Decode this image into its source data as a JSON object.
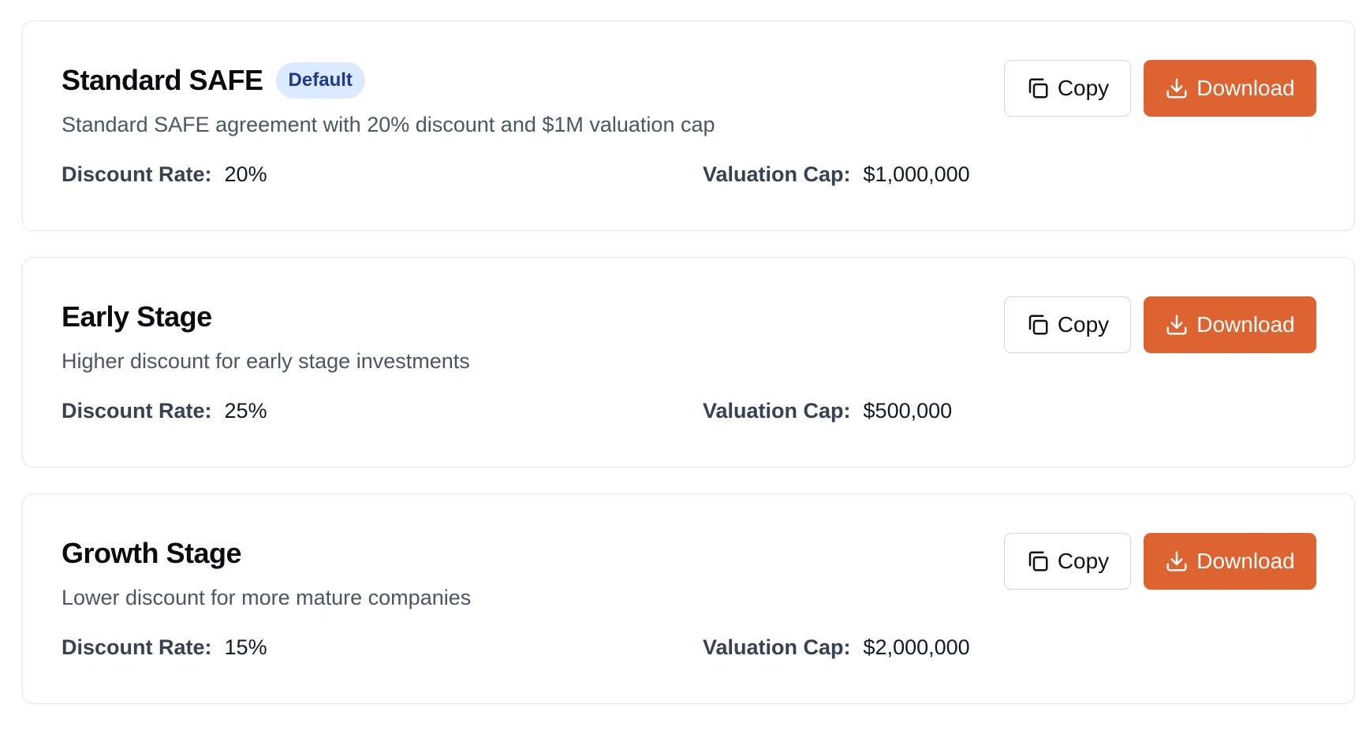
{
  "colors": {
    "download_bg": "#dd6330",
    "badge_bg": "#dbeafe",
    "badge_text": "#1e3a8a",
    "card_border": "#e5e7eb"
  },
  "icons": {
    "copy": "copy-icon",
    "download": "download-icon"
  },
  "templates": [
    {
      "title": "Standard SAFE",
      "badge": "Default",
      "description": "Standard SAFE agreement with 20% discount and $1M valuation cap",
      "discount_label": "Discount Rate:",
      "discount_value": "20%",
      "cap_label": "Valuation Cap:",
      "cap_value": "$1,000,000",
      "copy_label": "Copy",
      "download_label": "Download"
    },
    {
      "title": "Early Stage",
      "badge": "",
      "description": "Higher discount for early stage investments",
      "discount_label": "Discount Rate:",
      "discount_value": "25%",
      "cap_label": "Valuation Cap:",
      "cap_value": "$500,000",
      "copy_label": "Copy",
      "download_label": "Download"
    },
    {
      "title": "Growth Stage",
      "badge": "",
      "description": "Lower discount for more mature companies",
      "discount_label": "Discount Rate:",
      "discount_value": "15%",
      "cap_label": "Valuation Cap:",
      "cap_value": "$2,000,000",
      "copy_label": "Copy",
      "download_label": "Download"
    }
  ]
}
